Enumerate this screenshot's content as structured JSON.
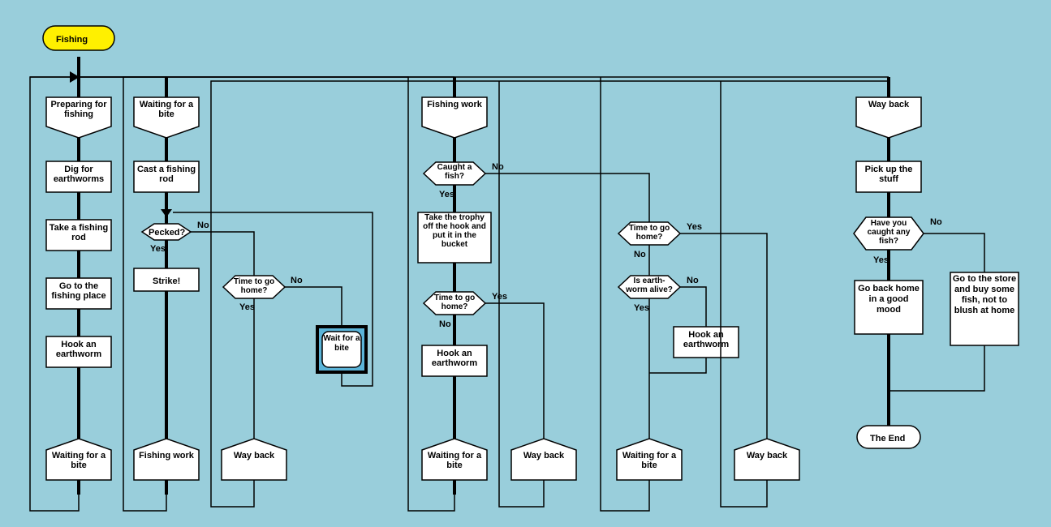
{
  "title": "Fishing",
  "col1": {
    "hdr": "Preparing for fishing",
    "b1": "Dig for earthworms",
    "b2": "Take a fishing rod",
    "b3": "Go to the fishing place",
    "b4": "Hook an earthworm",
    "ftr": "Waiting for a bite"
  },
  "col2": {
    "hdr": "Waiting for a bite",
    "b1": "Cast a fishing rod",
    "d1": "Pecked?",
    "b2": "Strike!",
    "d2": "Time to go home?",
    "sub": "Wait for a bite",
    "ftr1": "Fishing work",
    "ftr2": "Way back"
  },
  "col3": {
    "hdr": "Fishing work",
    "d1": "Caught a fish?",
    "b1": "Take the trophy off the hook and put it in the bucket",
    "d2": "Time to go home?",
    "b2": "Hook an earthworm",
    "d3": "Time to go home?",
    "d4": "Is earth- worm alive?",
    "b3": "Hook an earthworm",
    "ftr1": "Waiting for a bite",
    "ftr2": "Way back",
    "ftr3": "Waiting for a bite",
    "ftr4": "Way back"
  },
  "col4": {
    "hdr": "Way back",
    "b1": "Pick up the stuff",
    "d1": "Have you caught any fish?",
    "b2": "Go back home in a good mood",
    "b3": "Go to the store and buy some fish, not to blush at home",
    "end": "The End"
  },
  "labels": {
    "yes": "Yes",
    "no": "No"
  }
}
